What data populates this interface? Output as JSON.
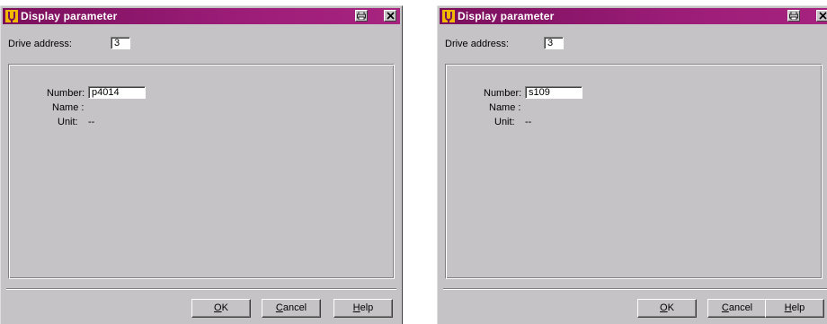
{
  "dialogs": [
    {
      "title": "Display  parameter",
      "drive_address_label": "Drive address:",
      "drive_address_value": "3",
      "number_label": "Number:",
      "number_value": "p4014",
      "name_label": "Name :",
      "unit_label": "Unit:",
      "unit_value": "--",
      "ok_mnemonic": "O",
      "ok_rest": "K",
      "cancel_mnemonic": "C",
      "cancel_rest": "ancel",
      "help_mnemonic": "H",
      "help_rest": "elp"
    },
    {
      "title": "Display  parameter",
      "drive_address_label": "Drive address:",
      "drive_address_value": "3",
      "number_label": "Number:",
      "number_value": "s109",
      "name_label": "Name :",
      "unit_label": "Unit:",
      "unit_value": "--",
      "ok_mnemonic": "O",
      "ok_rest": "K",
      "cancel_mnemonic": "C",
      "cancel_rest": "ancel",
      "help_mnemonic": "H",
      "help_rest": "elp"
    }
  ],
  "icons": {
    "app": "tuning-fork-icon",
    "print": "print-icon",
    "close": "close-icon"
  },
  "colors": {
    "titlebar": "#9c1d78",
    "dialog_face": "#c6c3c6"
  }
}
